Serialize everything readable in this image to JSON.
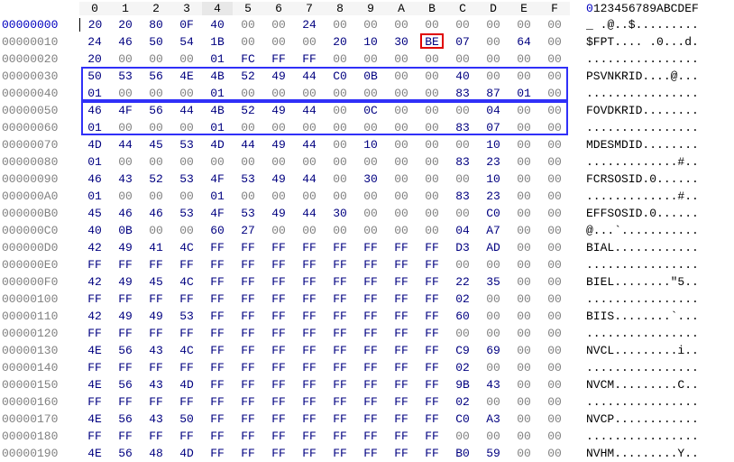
{
  "header": {
    "hex": [
      "0",
      "1",
      "2",
      "3",
      "4",
      "5",
      "6",
      "7",
      "8",
      "9",
      "A",
      "B",
      "C",
      "D",
      "E",
      "F"
    ],
    "ascii": "0123456789ABCDEF"
  },
  "rows": [
    {
      "addr": "00000000",
      "addrCls": "dark",
      "hex": [
        "20",
        "20",
        "80",
        "0F",
        "40",
        "00",
        "00",
        "24",
        "00",
        "00",
        "00",
        "00",
        "00",
        "00",
        "00",
        "00"
      ],
      "ascii": "_ .@..$........."
    },
    {
      "addr": "00000010",
      "addrCls": "gray",
      "hex": [
        "24",
        "46",
        "50",
        "54",
        "1B",
        "00",
        "00",
        "00",
        "20",
        "10",
        "30",
        "BE",
        "07",
        "00",
        "64",
        "00"
      ],
      "ascii": "$FPT.... .0...d."
    },
    {
      "addr": "00000020",
      "addrCls": "gray",
      "hex": [
        "20",
        "00",
        "00",
        "00",
        "01",
        "FC",
        "FF",
        "FF",
        "00",
        "00",
        "00",
        "00",
        "00",
        "00",
        "00",
        "00"
      ],
      "ascii": "................"
    },
    {
      "addr": "00000030",
      "addrCls": "gray",
      "hex": [
        "50",
        "53",
        "56",
        "4E",
        "4B",
        "52",
        "49",
        "44",
        "C0",
        "0B",
        "00",
        "00",
        "40",
        "00",
        "00",
        "00"
      ],
      "ascii": "PSVNKRID....@..."
    },
    {
      "addr": "00000040",
      "addrCls": "gray",
      "hex": [
        "01",
        "00",
        "00",
        "00",
        "01",
        "00",
        "00",
        "00",
        "00",
        "00",
        "00",
        "00",
        "83",
        "87",
        "01",
        "00"
      ],
      "ascii": "................"
    },
    {
      "addr": "00000050",
      "addrCls": "gray",
      "hex": [
        "46",
        "4F",
        "56",
        "44",
        "4B",
        "52",
        "49",
        "44",
        "00",
        "0C",
        "00",
        "00",
        "00",
        "04",
        "00",
        "00"
      ],
      "ascii": "FOVDKRID........"
    },
    {
      "addr": "00000060",
      "addrCls": "gray",
      "hex": [
        "01",
        "00",
        "00",
        "00",
        "01",
        "00",
        "00",
        "00",
        "00",
        "00",
        "00",
        "00",
        "83",
        "07",
        "00",
        "00"
      ],
      "ascii": "................"
    },
    {
      "addr": "00000070",
      "addrCls": "gray",
      "hex": [
        "4D",
        "44",
        "45",
        "53",
        "4D",
        "44",
        "49",
        "44",
        "00",
        "10",
        "00",
        "00",
        "00",
        "10",
        "00",
        "00"
      ],
      "ascii": "MDESMDID........"
    },
    {
      "addr": "00000080",
      "addrCls": "gray",
      "hex": [
        "01",
        "00",
        "00",
        "00",
        "00",
        "00",
        "00",
        "00",
        "00",
        "00",
        "00",
        "00",
        "83",
        "23",
        "00",
        "00"
      ],
      "ascii": ".............#.."
    },
    {
      "addr": "00000090",
      "addrCls": "gray",
      "hex": [
        "46",
        "43",
        "52",
        "53",
        "4F",
        "53",
        "49",
        "44",
        "00",
        "30",
        "00",
        "00",
        "00",
        "10",
        "00",
        "00"
      ],
      "ascii": "FCRSOSID.0......"
    },
    {
      "addr": "000000A0",
      "addrCls": "gray",
      "hex": [
        "01",
        "00",
        "00",
        "00",
        "01",
        "00",
        "00",
        "00",
        "00",
        "00",
        "00",
        "00",
        "83",
        "23",
        "00",
        "00"
      ],
      "ascii": ".............#.."
    },
    {
      "addr": "000000B0",
      "addrCls": "gray",
      "hex": [
        "45",
        "46",
        "46",
        "53",
        "4F",
        "53",
        "49",
        "44",
        "30",
        "00",
        "00",
        "00",
        "00",
        "C0",
        "00",
        "00"
      ],
      "ascii": "EFFSOSID.0......"
    },
    {
      "addr": "000000C0",
      "addrCls": "gray",
      "hex": [
        "40",
        "0B",
        "00",
        "00",
        "60",
        "27",
        "00",
        "00",
        "00",
        "00",
        "00",
        "00",
        "04",
        "A7",
        "00",
        "00"
      ],
      "ascii": "@...`..........."
    },
    {
      "addr": "000000D0",
      "addrCls": "gray",
      "hex": [
        "42",
        "49",
        "41",
        "4C",
        "FF",
        "FF",
        "FF",
        "FF",
        "FF",
        "FF",
        "FF",
        "FF",
        "D3",
        "AD",
        "00",
        "00"
      ],
      "ascii": "BIAL............"
    },
    {
      "addr": "000000E0",
      "addrCls": "gray",
      "hex": [
        "FF",
        "FF",
        "FF",
        "FF",
        "FF",
        "FF",
        "FF",
        "FF",
        "FF",
        "FF",
        "FF",
        "FF",
        "00",
        "00",
        "00",
        "00"
      ],
      "ascii": "................"
    },
    {
      "addr": "000000F0",
      "addrCls": "gray",
      "hex": [
        "42",
        "49",
        "45",
        "4C",
        "FF",
        "FF",
        "FF",
        "FF",
        "FF",
        "FF",
        "FF",
        "FF",
        "22",
        "35",
        "00",
        "00"
      ],
      "ascii": "BIEL........\"5.."
    },
    {
      "addr": "00000100",
      "addrCls": "gray",
      "hex": [
        "FF",
        "FF",
        "FF",
        "FF",
        "FF",
        "FF",
        "FF",
        "FF",
        "FF",
        "FF",
        "FF",
        "FF",
        "02",
        "00",
        "00",
        "00"
      ],
      "ascii": "................"
    },
    {
      "addr": "00000110",
      "addrCls": "gray",
      "hex": [
        "42",
        "49",
        "49",
        "53",
        "FF",
        "FF",
        "FF",
        "FF",
        "FF",
        "FF",
        "FF",
        "FF",
        "60",
        "00",
        "00",
        "00"
      ],
      "ascii": "BIIS........`..."
    },
    {
      "addr": "00000120",
      "addrCls": "gray",
      "hex": [
        "FF",
        "FF",
        "FF",
        "FF",
        "FF",
        "FF",
        "FF",
        "FF",
        "FF",
        "FF",
        "FF",
        "FF",
        "00",
        "00",
        "00",
        "00"
      ],
      "ascii": "................"
    },
    {
      "addr": "00000130",
      "addrCls": "gray",
      "hex": [
        "4E",
        "56",
        "43",
        "4C",
        "FF",
        "FF",
        "FF",
        "FF",
        "FF",
        "FF",
        "FF",
        "FF",
        "C9",
        "69",
        "00",
        "00"
      ],
      "ascii": "NVCL.........i.."
    },
    {
      "addr": "00000140",
      "addrCls": "gray",
      "hex": [
        "FF",
        "FF",
        "FF",
        "FF",
        "FF",
        "FF",
        "FF",
        "FF",
        "FF",
        "FF",
        "FF",
        "FF",
        "02",
        "00",
        "00",
        "00"
      ],
      "ascii": "................"
    },
    {
      "addr": "00000150",
      "addrCls": "gray",
      "hex": [
        "4E",
        "56",
        "43",
        "4D",
        "FF",
        "FF",
        "FF",
        "FF",
        "FF",
        "FF",
        "FF",
        "FF",
        "9B",
        "43",
        "00",
        "00"
      ],
      "ascii": "NVCM.........C.."
    },
    {
      "addr": "00000160",
      "addrCls": "gray",
      "hex": [
        "FF",
        "FF",
        "FF",
        "FF",
        "FF",
        "FF",
        "FF",
        "FF",
        "FF",
        "FF",
        "FF",
        "FF",
        "02",
        "00",
        "00",
        "00"
      ],
      "ascii": "................"
    },
    {
      "addr": "00000170",
      "addrCls": "gray",
      "hex": [
        "4E",
        "56",
        "43",
        "50",
        "FF",
        "FF",
        "FF",
        "FF",
        "FF",
        "FF",
        "FF",
        "FF",
        "C0",
        "A3",
        "00",
        "00"
      ],
      "ascii": "NVCP............"
    },
    {
      "addr": "00000180",
      "addrCls": "gray",
      "hex": [
        "FF",
        "FF",
        "FF",
        "FF",
        "FF",
        "FF",
        "FF",
        "FF",
        "FF",
        "FF",
        "FF",
        "FF",
        "00",
        "00",
        "00",
        "00"
      ],
      "ascii": "................"
    },
    {
      "addr": "00000190",
      "addrCls": "gray",
      "hex": [
        "4E",
        "56",
        "48",
        "4D",
        "FF",
        "FF",
        "FF",
        "FF",
        "FF",
        "FF",
        "FF",
        "FF",
        "B0",
        "59",
        "00",
        "00"
      ],
      "ascii": "NVHM.........Y.."
    }
  ],
  "highlights": {
    "red": {
      "rowIndex": 1,
      "col": 11
    },
    "blue": [
      {
        "startRow": 3,
        "rows": 2
      },
      {
        "startRow": 5,
        "rows": 2
      }
    ]
  }
}
